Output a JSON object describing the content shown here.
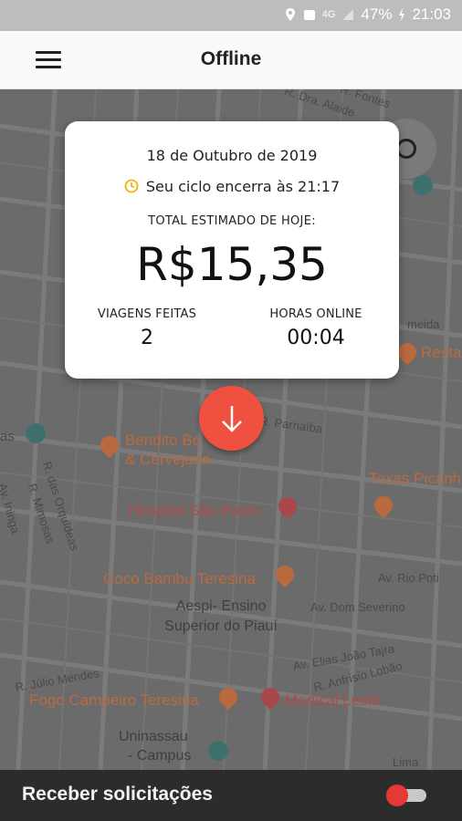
{
  "status_bar": {
    "battery": "47%",
    "network": "4G",
    "time": "21:03"
  },
  "app_bar": {
    "title": "Offline",
    "menu_icon": "hamburger-menu-icon"
  },
  "summary_card": {
    "date": "18 de  Outubro de  2019",
    "cycle_text": "Seu ciclo encerra às 21:17",
    "total_label": "TOTAL ESTIMADO DE HOJE:",
    "total_value": "R$15,35",
    "trips_label": "VIAGENS FEITAS",
    "trips_value": "2",
    "hours_label": "HORAS ONLINE",
    "hours_value": "00:04"
  },
  "map": {
    "streets": {
      "dra_alaide": "R. Dra. Alaide",
      "fontes": "R. Fontes",
      "parnaiba": "R. Parnaíba",
      "orquideas": "R. das Orquídeas",
      "mimosas": "R. Mimosas",
      "ininga": "Av. Ininga",
      "rio_poti": "Av. Rio Poti",
      "dom_severino": "Av. Dom Severino",
      "elias_joao_tajra": "Av. Elias João Tajra",
      "anfrisio_lobao": "R. Anfrísio Lobão",
      "julio_mendes": "R. Júlio Mendes",
      "lima": "Lima",
      "meida": "meida",
      "as": "as"
    },
    "places": {
      "bendito": "Bendito Bo",
      "cervejaria": "& Cervejaria",
      "texas": "Texas Picanh",
      "hospital": "Hospital São Paulo",
      "coco_bambu": "Coco Bambu Teresina",
      "aespi_1": "Aespi- Ensino",
      "aespi_2": "Superior do Piauí",
      "fogo": "Fogo Campeiro Teresina",
      "medical": "Medical Leste",
      "uninassau_1": "Uninassau",
      "uninassau_2": "- Campus",
      "resta": "Resta"
    }
  },
  "bottom_bar": {
    "label": "Receber solicitações",
    "toggle_on": false,
    "toggle_color": "#e53935"
  },
  "colors": {
    "fab": "#f05040",
    "cycle_icon": "#f0b400"
  }
}
